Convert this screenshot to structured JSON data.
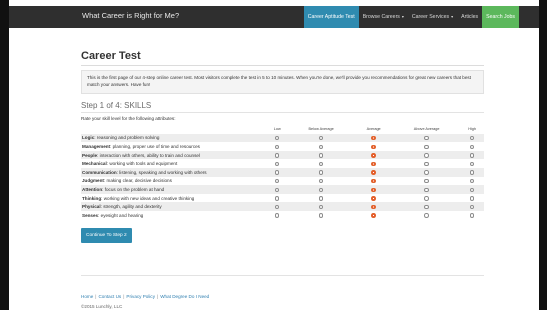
{
  "nav": {
    "brand": "What Career is Right for Me?",
    "items": [
      {
        "label": "Career Aptitude Test",
        "style": "blue",
        "caret": false
      },
      {
        "label": "Browse Careers",
        "style": "none",
        "caret": true
      },
      {
        "label": "Career Services",
        "style": "none",
        "caret": true
      },
      {
        "label": "Articles",
        "style": "none",
        "caret": false
      },
      {
        "label": "Search Jobs",
        "style": "green",
        "caret": false
      }
    ],
    "caret_glyph": "▾"
  },
  "main": {
    "title": "Career Test",
    "intro": "This is the first page of our 4-step online career test. Most visitors complete the test in 5 to 10 minutes. When you're done, we'll provide you recommendations for great new careers that best match your answers. Have fun!",
    "step_title": "Step 1 of 4: SKILLS",
    "rate_text": "Rate your skill level for the following attributes:",
    "columns": [
      "Low",
      "Below Average",
      "Average",
      "Above Average",
      "High"
    ],
    "rows": [
      {
        "name": "Logic",
        "desc": ": reasoning and problem solving",
        "selected": 2
      },
      {
        "name": "Management",
        "desc": ": planning, proper use of time and resources",
        "selected": 2
      },
      {
        "name": "People",
        "desc": ": interaction with others, ability to train and counsel",
        "selected": 2
      },
      {
        "name": "Mechanical",
        "desc": ": working with tools and equipment",
        "selected": 2
      },
      {
        "name": "Communication",
        "desc": ": listening, speaking and working with others",
        "selected": 2
      },
      {
        "name": "Judgment",
        "desc": ": making clear, decisive decisions",
        "selected": 2
      },
      {
        "name": "Attention",
        "desc": ": focus on the problem at hand",
        "selected": 2
      },
      {
        "name": "Thinking",
        "desc": ": working with new ideas and creative thinking",
        "selected": 2
      },
      {
        "name": "Physical",
        "desc": ": strength, agility and dexterity",
        "selected": 2
      },
      {
        "name": "Senses",
        "desc": ": eyesight and hearing",
        "selected": 2
      }
    ],
    "button_label": "Continue To Step 2"
  },
  "footer": {
    "links": [
      "Home",
      "Contact Us",
      "Privacy Policy",
      "What Degree Do I Need"
    ],
    "separator": "|",
    "copyright": "©2015 Lunchly, LLC"
  },
  "colors": {
    "navbar": "#2f2f2f",
    "accent_blue": "#2f8bb0",
    "accent_green": "#5cb85c",
    "radio_selected": "#e8592a"
  }
}
